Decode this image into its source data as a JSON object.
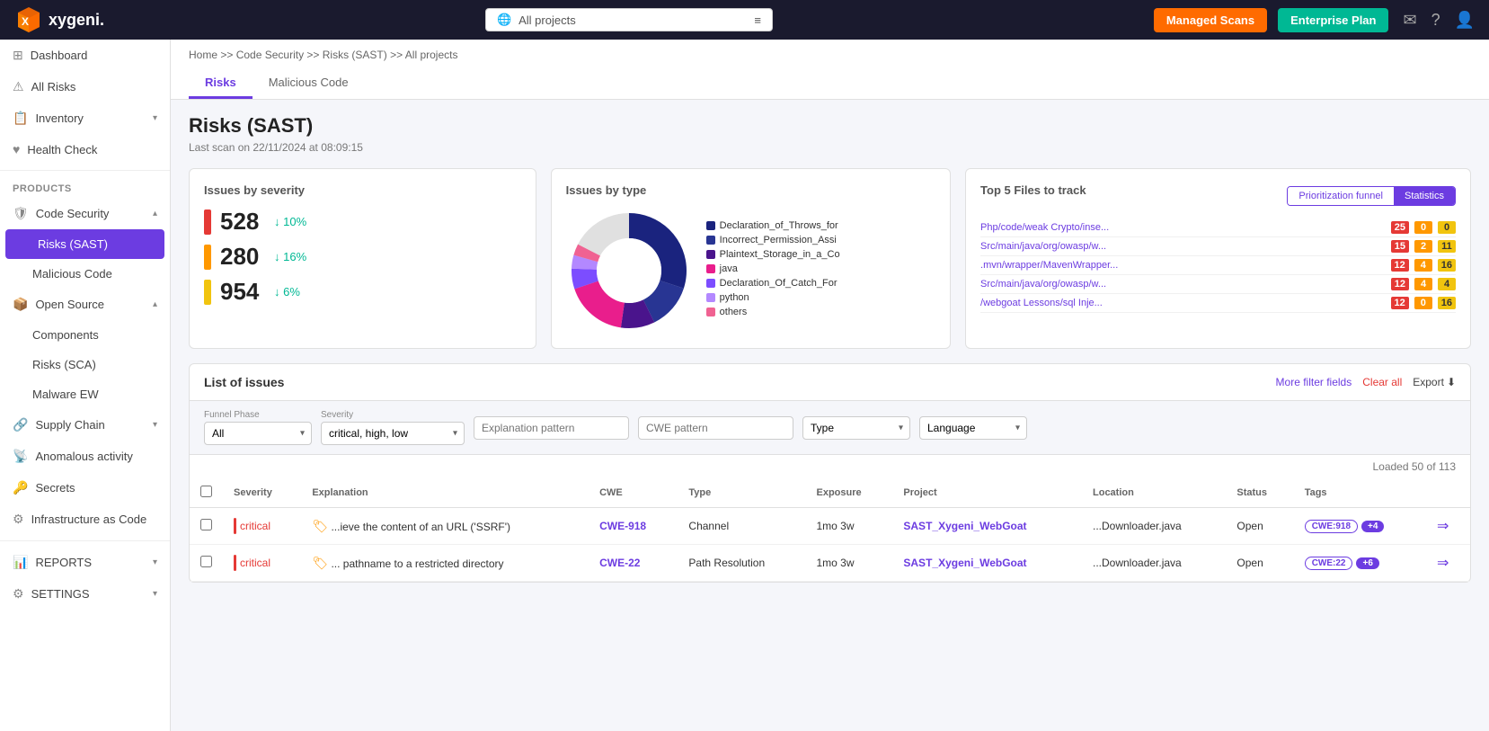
{
  "app": {
    "name": "xygeni",
    "logo_text": "xygeni."
  },
  "topnav": {
    "search_placeholder": "All projects",
    "managed_scans_label": "Managed Scans",
    "enterprise_label": "Enterprise Plan"
  },
  "sidebar": {
    "dashboard_label": "Dashboard",
    "all_risks_label": "All Risks",
    "inventory_label": "Inventory",
    "health_check_label": "Health Check",
    "products_label": "PRODUCTS",
    "code_security_label": "Code Security",
    "risks_sast_label": "Risks (SAST)",
    "malicious_code_label": "Malicious Code",
    "open_source_label": "Open Source",
    "components_label": "Components",
    "risks_sca_label": "Risks (SCA)",
    "malware_ew_label": "Malware EW",
    "supply_chain_label": "Supply Chain",
    "anomalous_label": "Anomalous activity",
    "secrets_label": "Secrets",
    "iac_label": "Infrastructure as Code",
    "reports_label": "REPORTS",
    "settings_label": "SETTINGS"
  },
  "breadcrumb": {
    "items": [
      "Home",
      "Code Security",
      "Risks (SAST)",
      "All projects"
    ]
  },
  "tabs": {
    "risks_label": "Risks",
    "malicious_label": "Malicious Code"
  },
  "page": {
    "title": "Risks (SAST)",
    "scan_info": "Last scan on 22/11/2024 at 08:09:15"
  },
  "severity_card": {
    "title": "Issues by severity",
    "critical_count": "528",
    "critical_change": "↓ 10%",
    "high_count": "280",
    "high_change": "↓ 16%",
    "medium_count": "954",
    "medium_change": "↓ 6%"
  },
  "type_card": {
    "title": "Issues by type",
    "legend": [
      {
        "label": "Declaration_of_Throws_for",
        "color": "#1a237e"
      },
      {
        "label": "Incorrect_Permission_Assi",
        "color": "#283593"
      },
      {
        "label": "Plaintext_Storage_in_a_Co",
        "color": "#4a148c"
      },
      {
        "label": "java",
        "color": "#e91e8c"
      },
      {
        "label": "Declaration_Of_Catch_For",
        "color": "#7c4dff"
      },
      {
        "label": "python",
        "color": "#b388ff"
      },
      {
        "label": "others",
        "color": "#f06292"
      }
    ]
  },
  "files_card": {
    "title": "Top 5 Files to track",
    "toggle_prioritization": "Prioritization funnel",
    "toggle_statistics": "Statistics",
    "files": [
      {
        "name": "Php/code/weak Crypto/inse...",
        "red": 25,
        "orange": 0,
        "yellow": 0
      },
      {
        "name": "Src/main/java/org/owasp/w...",
        "red": 15,
        "orange": 2,
        "yellow": 11
      },
      {
        "name": ".mvn/wrapper/MavenWrapper...",
        "red": 12,
        "orange": 4,
        "yellow": 16
      },
      {
        "name": "Src/main/java/org/owasp/w...",
        "red": 12,
        "orange": 4,
        "yellow": 4
      },
      {
        "name": "/webgoat Lessons/sql Inje...",
        "red": 12,
        "orange": 0,
        "yellow": 16
      }
    ]
  },
  "list_section": {
    "title": "List of issues",
    "more_filter_fields": "More filter fields",
    "clear_all": "Clear all",
    "export": "Export",
    "loaded_info": "Loaded 50 of 113"
  },
  "filters": {
    "funnel_phase_label": "Funnel Phase",
    "funnel_phase_value": "All",
    "severity_label": "Severity",
    "severity_value": "critical, high, low",
    "explanation_placeholder": "Explanation pattern",
    "cwe_placeholder": "CWE pattern",
    "type_label": "Type",
    "type_placeholder": "Type",
    "language_label": "Language",
    "language_placeholder": "Language"
  },
  "table": {
    "headers": [
      "Severity",
      "Explanation",
      "CWE",
      "Type",
      "Exposure",
      "Project",
      "Location",
      "Status",
      "Tags"
    ],
    "rows": [
      {
        "severity": "critical",
        "explanation": "...ieve the content of an URL ('SSRF')",
        "cwe": "CWE-918",
        "type": "Channel",
        "exposure": "1mo 3w",
        "project": "SAST_Xygeni_WebGoat",
        "location": "...Downloader.java",
        "status": "Open",
        "tags": [
          "CWE:918"
        ],
        "more_tags": "+4"
      },
      {
        "severity": "critical",
        "explanation": "... pathname to a restricted directory",
        "cwe": "CWE-22",
        "type": "Path Resolution",
        "exposure": "1mo 3w",
        "project": "SAST_Xygeni_WebGoat",
        "location": "...Downloader.java",
        "status": "Open",
        "tags": [
          "CWE:22"
        ],
        "more_tags": "+6"
      }
    ]
  }
}
